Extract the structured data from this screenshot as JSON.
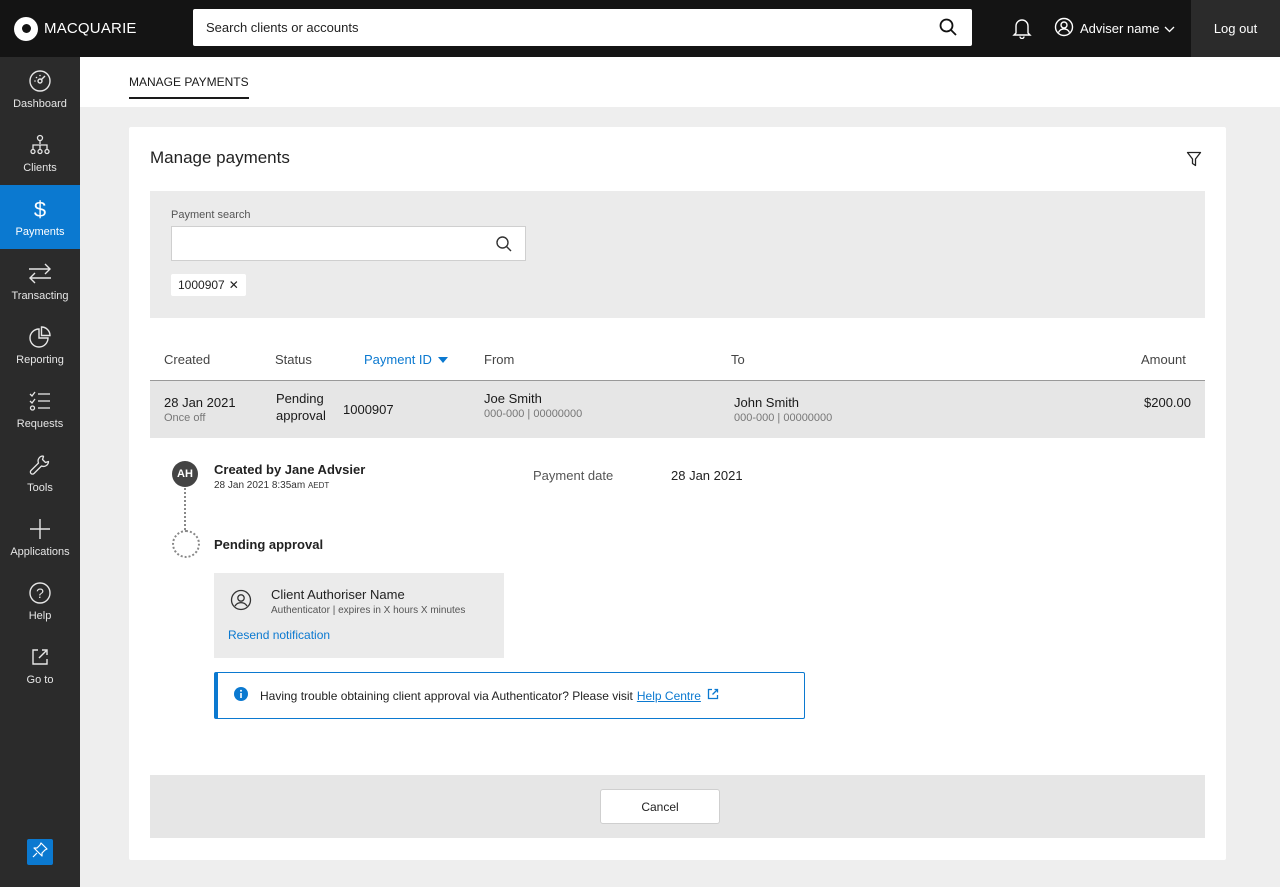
{
  "brand": {
    "name": "MACQUARIE"
  },
  "header": {
    "search_placeholder": "Search clients or accounts",
    "user_label": "Adviser name",
    "logout_label": "Log out"
  },
  "sidebar": {
    "items": [
      {
        "label": "Dashboard",
        "icon": "dashboard-icon"
      },
      {
        "label": "Clients",
        "icon": "clients-icon"
      },
      {
        "label": "Payments",
        "icon": "dollar-icon",
        "active": true
      },
      {
        "label": "Transacting",
        "icon": "transfer-icon"
      },
      {
        "label": "Reporting",
        "icon": "pie-chart-icon"
      },
      {
        "label": "Requests",
        "icon": "checklist-icon"
      },
      {
        "label": "Tools",
        "icon": "wrench-icon"
      },
      {
        "label": "Applications",
        "icon": "plus-icon"
      },
      {
        "label": "Help",
        "icon": "help-icon"
      },
      {
        "label": "Go to",
        "icon": "external-link-icon"
      }
    ]
  },
  "subheader": {
    "tab": "MANAGE PAYMENTS"
  },
  "card": {
    "title": "Manage payments",
    "payment_search": {
      "label": "Payment search",
      "value": "",
      "chip": "1000907"
    },
    "columns": {
      "created": "Created",
      "status": "Status",
      "payment_id": "Payment ID",
      "from": "From",
      "to": "To",
      "amount": "Amount"
    },
    "row": {
      "created": "28 Jan 2021",
      "frequency": "Once off",
      "status_line1": "Pending",
      "status_line2": "approval",
      "payment_id": "1000907",
      "from_name": "Joe Smith",
      "from_account": "000-000 | 00000000",
      "to_name": "John Smith",
      "to_account": "000-000 | 00000000",
      "amount": "$200.00"
    },
    "detail": {
      "avatar_initials": "AH",
      "created_by": "Created by Jane Advsier",
      "created_time": "28 Jan 2021 8:35am",
      "created_tz": "AEDT",
      "payment_date_label": "Payment date",
      "payment_date_value": "28 Jan 2021",
      "pending_title": "Pending approval",
      "authoriser_name": "Client Authoriser Name",
      "authoriser_sub": "Authenticator | expires in X hours X minutes",
      "resend_label": "Resend notification",
      "info_text": "Having trouble obtaining client approval via Authenticator? Please visit",
      "help_link": "Help Centre"
    },
    "cancel_label": "Cancel"
  },
  "colors": {
    "accent": "#0b79d0",
    "topbar": "#141414",
    "sidebar": "#2b2b2b"
  }
}
